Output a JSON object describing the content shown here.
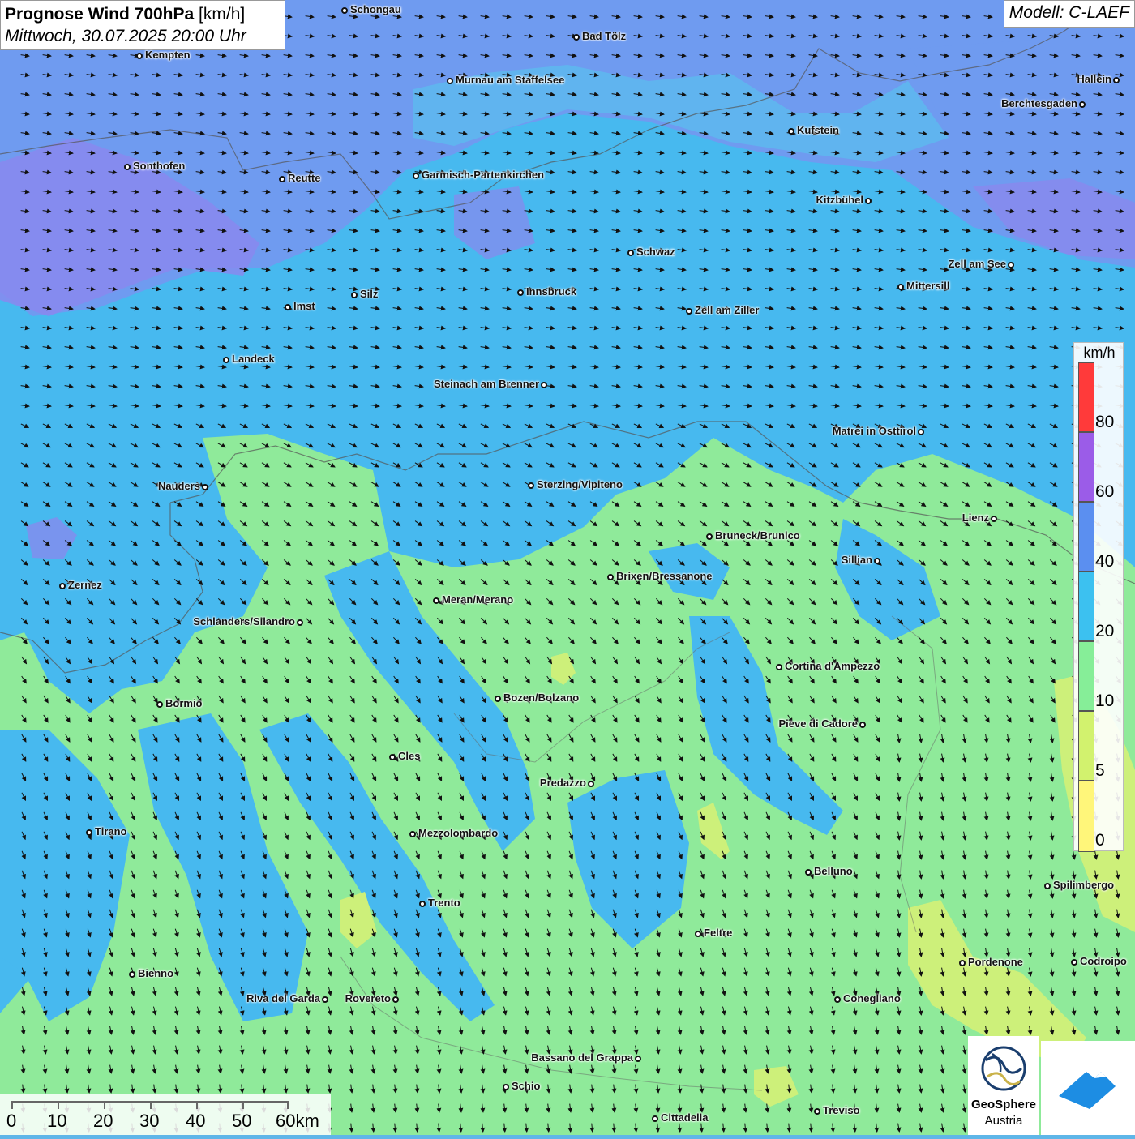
{
  "header": {
    "title_bold": "Prognose Wind 700hPa",
    "title_unit": "[km/h]",
    "datetime": "Mittwoch, 30.07.2025 20:00 Uhr",
    "model": "Modell: C-LAEF"
  },
  "legend": {
    "unit": "km/h",
    "ticks": [
      "80",
      "60",
      "40",
      "20",
      "10",
      "5",
      "0"
    ],
    "colors": [
      "#ff3a3a",
      "#9b5ce8",
      "#5b8ff0",
      "#3cc1f0",
      "#86ee98",
      "#d2f26e",
      "#fff67a"
    ]
  },
  "scalebar": {
    "labels": [
      "0",
      "10",
      "20",
      "30",
      "40",
      "50",
      "60km"
    ]
  },
  "logos": {
    "geosphere_line1": "GeoSphere",
    "geosphere_line2": "Austria"
  },
  "cities": [
    {
      "id": "schongau",
      "name": "Schongau",
      "label_side": "right"
    },
    {
      "id": "bad-toelz",
      "name": "Bad Tölz",
      "label_side": "right"
    },
    {
      "id": "kempten",
      "name": "Kempten",
      "label_side": "right"
    },
    {
      "id": "murnau",
      "name": "Murnau am Staffelsee",
      "label_side": "right"
    },
    {
      "id": "hallein",
      "name": "Hallein",
      "label_side": "left"
    },
    {
      "id": "berchtesgaden",
      "name": "Berchtesgaden",
      "label_side": "left"
    },
    {
      "id": "kufstein",
      "name": "Kufstein",
      "label_side": "right"
    },
    {
      "id": "sonthofen",
      "name": "Sonthofen",
      "label_side": "right"
    },
    {
      "id": "reutte",
      "name": "Reutte",
      "label_side": "right"
    },
    {
      "id": "garmisch",
      "name": "Garmisch-Partenkirchen",
      "label_side": "right"
    },
    {
      "id": "kitzbuehel",
      "name": "Kitzbühel",
      "label_side": "left"
    },
    {
      "id": "schwaz",
      "name": "Schwaz",
      "label_side": "right"
    },
    {
      "id": "zell-am-see",
      "name": "Zell am See",
      "label_side": "left"
    },
    {
      "id": "mittersill",
      "name": "Mittersill",
      "label_side": "right"
    },
    {
      "id": "innsbruck",
      "name": "Innsbruck",
      "label_side": "right"
    },
    {
      "id": "silz",
      "name": "Silz",
      "label_side": "right"
    },
    {
      "id": "imst",
      "name": "Imst",
      "label_side": "right"
    },
    {
      "id": "zell-am-ziller",
      "name": "Zell am Ziller",
      "label_side": "right"
    },
    {
      "id": "landeck",
      "name": "Landeck",
      "label_side": "right"
    },
    {
      "id": "steinach",
      "name": "Steinach am Brenner",
      "label_side": "left"
    },
    {
      "id": "matrei",
      "name": "Matrei in Osttirol",
      "label_side": "left"
    },
    {
      "id": "nauders",
      "name": "Nauders",
      "label_side": "left"
    },
    {
      "id": "sterzing",
      "name": "Sterzing/Vipiteno",
      "label_side": "right"
    },
    {
      "id": "lienz",
      "name": "Lienz",
      "label_side": "left"
    },
    {
      "id": "bruneck",
      "name": "Bruneck/Brunico",
      "label_side": "right"
    },
    {
      "id": "sillian",
      "name": "Sillian",
      "label_side": "left"
    },
    {
      "id": "brixen",
      "name": "Brixen/Bressanone",
      "label_side": "right"
    },
    {
      "id": "zernez",
      "name": "Zernez",
      "label_side": "right"
    },
    {
      "id": "meran",
      "name": "Meran/Merano",
      "label_side": "right"
    },
    {
      "id": "schlanders",
      "name": "Schlanders/Silandro",
      "label_side": "left"
    },
    {
      "id": "cortina",
      "name": "Cortina d'Ampezzo",
      "label_side": "right"
    },
    {
      "id": "bozen",
      "name": "Bozen/Bolzano",
      "label_side": "right"
    },
    {
      "id": "bormio",
      "name": "Bormio",
      "label_side": "right"
    },
    {
      "id": "pieve",
      "name": "Pieve di Cadore",
      "label_side": "left"
    },
    {
      "id": "cles",
      "name": "Cles",
      "label_side": "right"
    },
    {
      "id": "predazzo",
      "name": "Predazzo",
      "label_side": "left"
    },
    {
      "id": "tirano",
      "name": "Tirano",
      "label_side": "right"
    },
    {
      "id": "mezzolombardo",
      "name": "Mezzolombardo",
      "label_side": "right"
    },
    {
      "id": "belluno",
      "name": "Belluno",
      "label_side": "right"
    },
    {
      "id": "spilimbergo",
      "name": "Spilimbergo",
      "label_side": "right"
    },
    {
      "id": "trento",
      "name": "Trento",
      "label_side": "right"
    },
    {
      "id": "feltre",
      "name": "Feltre",
      "label_side": "right"
    },
    {
      "id": "bienno",
      "name": "Bienno",
      "label_side": "right"
    },
    {
      "id": "pordenone",
      "name": "Pordenone",
      "label_side": "right"
    },
    {
      "id": "codroipo",
      "name": "Codroipo",
      "label_side": "right"
    },
    {
      "id": "riva",
      "name": "Riva del Garda",
      "label_side": "left"
    },
    {
      "id": "rovereto",
      "name": "Rovereto",
      "label_side": "left"
    },
    {
      "id": "conegliano",
      "name": "Conegliano",
      "label_side": "right"
    },
    {
      "id": "bassano",
      "name": "Bassano del Grappa",
      "label_side": "left"
    },
    {
      "id": "schio",
      "name": "Schio",
      "label_side": "right"
    },
    {
      "id": "treviso",
      "name": "Treviso",
      "label_side": "right"
    },
    {
      "id": "cittadella",
      "name": "Cittadella",
      "label_side": "right"
    }
  ]
}
